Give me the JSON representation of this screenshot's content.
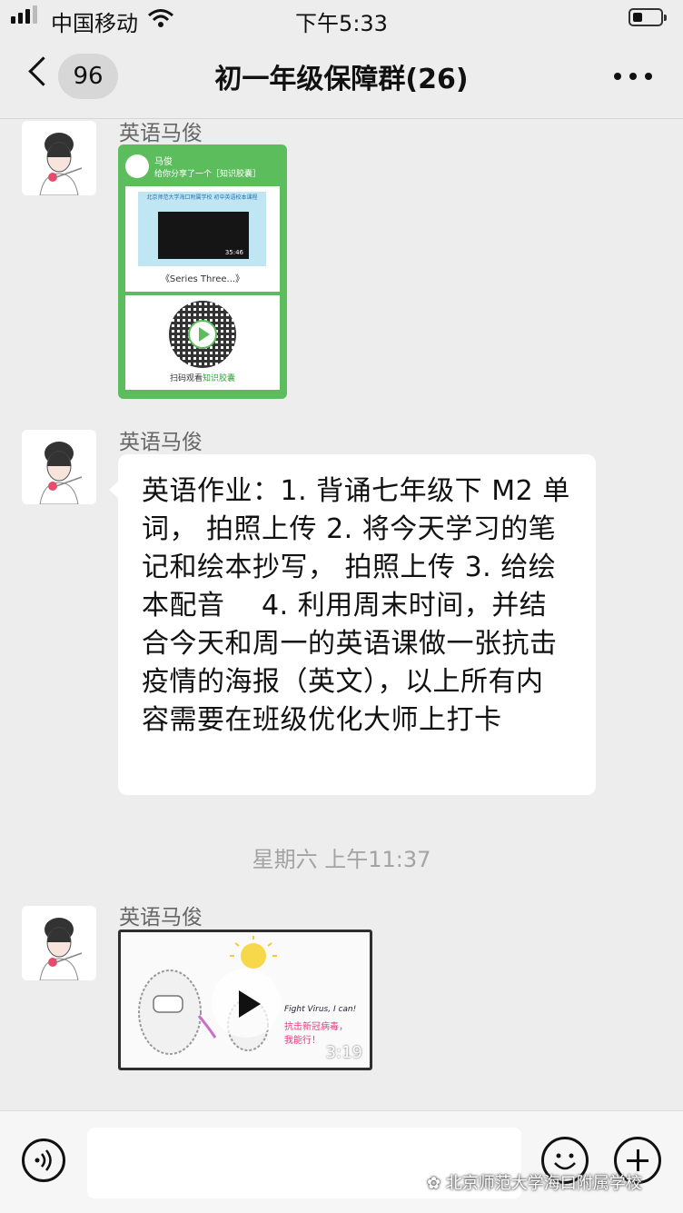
{
  "status_bar": {
    "carrier": "中国移动",
    "time": "下午5:33"
  },
  "nav": {
    "unread_count": "96",
    "title": "初一年级保障群(26)"
  },
  "messages": [
    {
      "sender": "英语马俊",
      "card": {
        "owner": "马俊",
        "share_text": "给你分享了一个［知识胶囊］",
        "school": "北京师范大学海口附属学校 初中英语校本课程",
        "video_time": "35:46",
        "series_title": "《Series Three...》",
        "scan_prefix": "扫码观看",
        "scan_highlight": "知识胶囊"
      }
    },
    {
      "sender": "英语马俊",
      "text": "英语作业：1. 背诵七年级下 M2 单词， 拍照上传 2. 将今天学习的笔记和绘本抄写， 拍照上传 3. 给绘本配音　 4. 利用周末时间，并结合今天和周一的英语课做一张抗击疫情的海报（英文），以上所有内容需要在班级优化大师上打卡"
    },
    {
      "sender": "英语马俊",
      "video": {
        "duration": "3:19",
        "caption_en": "Fight Virus, I can!",
        "caption_cn1": "抗击新冠病毒，",
        "caption_cn2": "我能行！"
      }
    }
  ],
  "timestamp": "星期六 上午11:37",
  "watermark": "北京师范大学海口附属学校",
  "colors": {
    "card_green": "#5cbd5d",
    "chat_bg": "#ededed",
    "bubble": "#ffffff"
  }
}
